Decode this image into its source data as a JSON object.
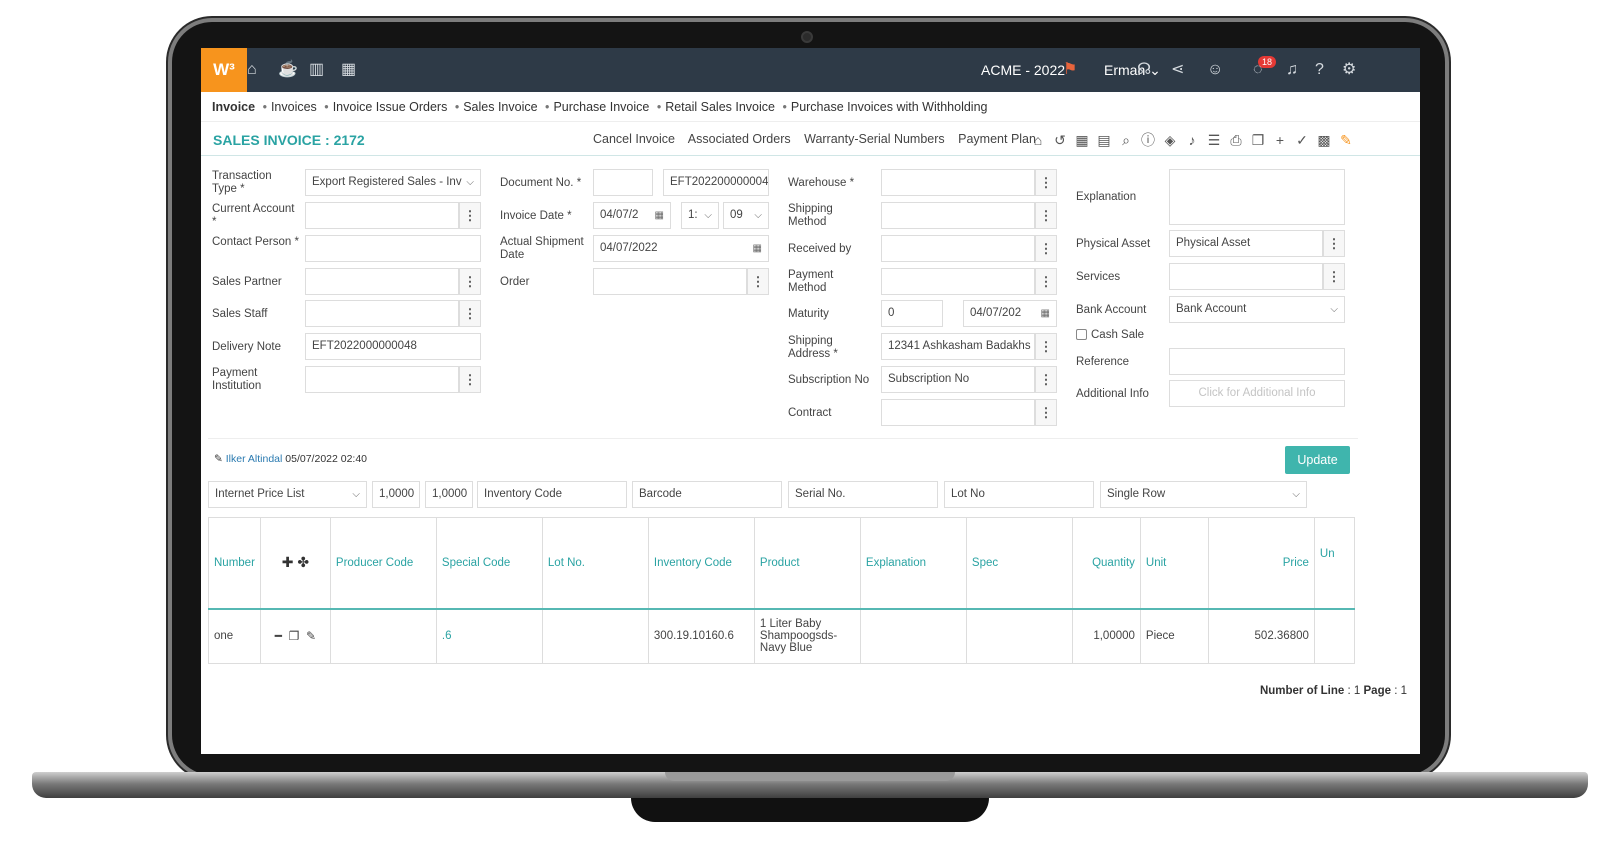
{
  "app": {
    "logo": "W³",
    "company": "ACME - 2022",
    "user": "Erman",
    "notif_count": "18"
  },
  "tabs": [
    "Invoice",
    "Invoices",
    "Invoice Issue Orders",
    "Sales Invoice",
    "Purchase Invoice",
    "Retail Sales Invoice",
    "Purchase Invoices with Withholding"
  ],
  "page": {
    "title": "SALES INVOICE : 2172"
  },
  "actions": [
    "Cancel Invoice",
    "Associated Orders",
    "Warranty-Serial Numbers",
    "Payment Plan"
  ],
  "form": {
    "transaction_type_label": "Transaction Type *",
    "transaction_type": "Export Registered Sales - Inv",
    "current_account_label": "Current Account *",
    "contact_person_label": "Contact Person *",
    "sales_partner_label": "Sales Partner",
    "sales_staff_label": "Sales Staff",
    "delivery_note_label": "Delivery Note",
    "delivery_note": "EFT2022000000048",
    "payment_institution_label": "Payment Institution",
    "document_no_label": "Document No. *",
    "document_no": "EFT202200000004",
    "invoice_date_label": "Invoice Date *",
    "invoice_date": "04/07/2",
    "hour": "1:",
    "minute": "09",
    "actual_shipment_label": "Actual Shipment Date",
    "actual_shipment": "04/07/2022",
    "order_label": "Order",
    "warehouse_label": "Warehouse *",
    "shipping_method_label": "Shipping Method",
    "received_by_label": "Received by",
    "payment_method_label": "Payment Method",
    "maturity_label": "Maturity",
    "maturity": "0",
    "maturity_date": "04/07/202",
    "shipping_address_label": "Shipping Address *",
    "shipping_address": "12341 Ashkasham Badakhs",
    "subscription_label": "Subscription No",
    "subscription": "Subscription No",
    "contract_label": "Contract",
    "explanation_label": "Explanation",
    "physical_asset_label": "Physical Asset",
    "physical_asset": "Physical Asset",
    "services_label": "Services",
    "bank_account_label": "Bank Account",
    "bank_account": "Bank Account",
    "cash_sale_label": "Cash Sale",
    "reference_label": "Reference",
    "additional_info_label": "Additional Info",
    "additional_info_placeholder": "Click for Additional Info"
  },
  "meta": {
    "author": "Ilker Altindal",
    "timestamp": "05/07/2022 02:40"
  },
  "update_label": "Update",
  "filters": {
    "price_list": "Internet Price List",
    "rate1": "1,0000",
    "rate2": "1,0000",
    "inventory_code": "Inventory Code",
    "barcode": "Barcode",
    "serial_no": "Serial No.",
    "lot_no": "Lot No",
    "row_mode": "Single Row"
  },
  "table": {
    "headers": [
      "Number",
      "",
      "Producer Code",
      "Special Code",
      "Lot No.",
      "Inventory Code",
      "Product",
      "Explanation",
      "Spec",
      "Quantity",
      "Unit",
      "Price",
      "Un"
    ],
    "rows": [
      [
        "one",
        "",
        "",
        ".6",
        "",
        "300.19.10160.6",
        "1 Liter Baby Shampoogsds-Navy Blue",
        "",
        "",
        "1,00000",
        "Piece",
        "502.36800",
        ""
      ]
    ]
  },
  "footer": {
    "lines_label": "Number of Line",
    "lines": "1",
    "page_label": "Page",
    "page": "1"
  },
  "colors": {
    "accent": "#3fb5ad",
    "topbar": "#2e3a47",
    "logo": "#f7941d"
  }
}
